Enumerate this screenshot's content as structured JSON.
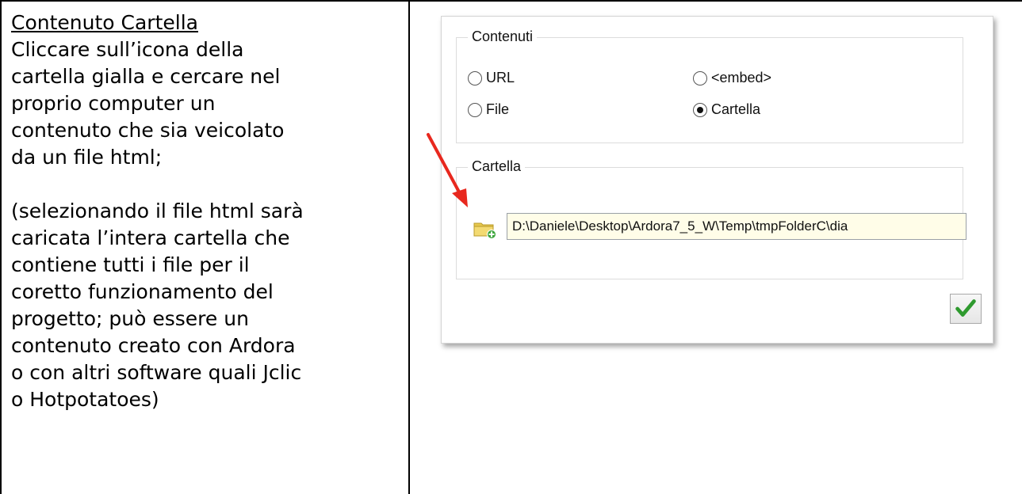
{
  "instructions": {
    "heading": "Contenuto Cartella",
    "para1_lines": [
      "Cliccare sull’icona della",
      "cartella gialla e cercare nel",
      "proprio computer un",
      "contenuto che sia veicolato",
      "da un file html;"
    ],
    "para2_lines": [
      "(selezionando il file html sarà",
      "caricata l’intera cartella che",
      "contiene tutti i file per il",
      "coretto funzionamento del",
      "progetto; può essere un",
      "contenuto creato con Ardora",
      "o con altri software quali Jclic",
      "o Hotpotatoes)"
    ]
  },
  "dialog": {
    "contenuti_group": {
      "title": "Contenuti",
      "options": [
        {
          "label": "URL",
          "checked": false
        },
        {
          "label": "<embed>",
          "checked": false
        },
        {
          "label": "File",
          "checked": false
        },
        {
          "label": "Cartella",
          "checked": true
        }
      ]
    },
    "cartella_group": {
      "title": "Cartella",
      "path_value": "D:\\Daniele\\Desktop\\Ardora7_5_W\\Temp\\tmpFolderC\\dia",
      "folder_icon": "folder-add-icon"
    },
    "ok_icon": "checkmark-icon"
  },
  "colors": {
    "arrow": "#e8281e",
    "checkmark": "#2e9a2e",
    "folder": "#e7c84e",
    "input_bg": "#fffde8"
  }
}
